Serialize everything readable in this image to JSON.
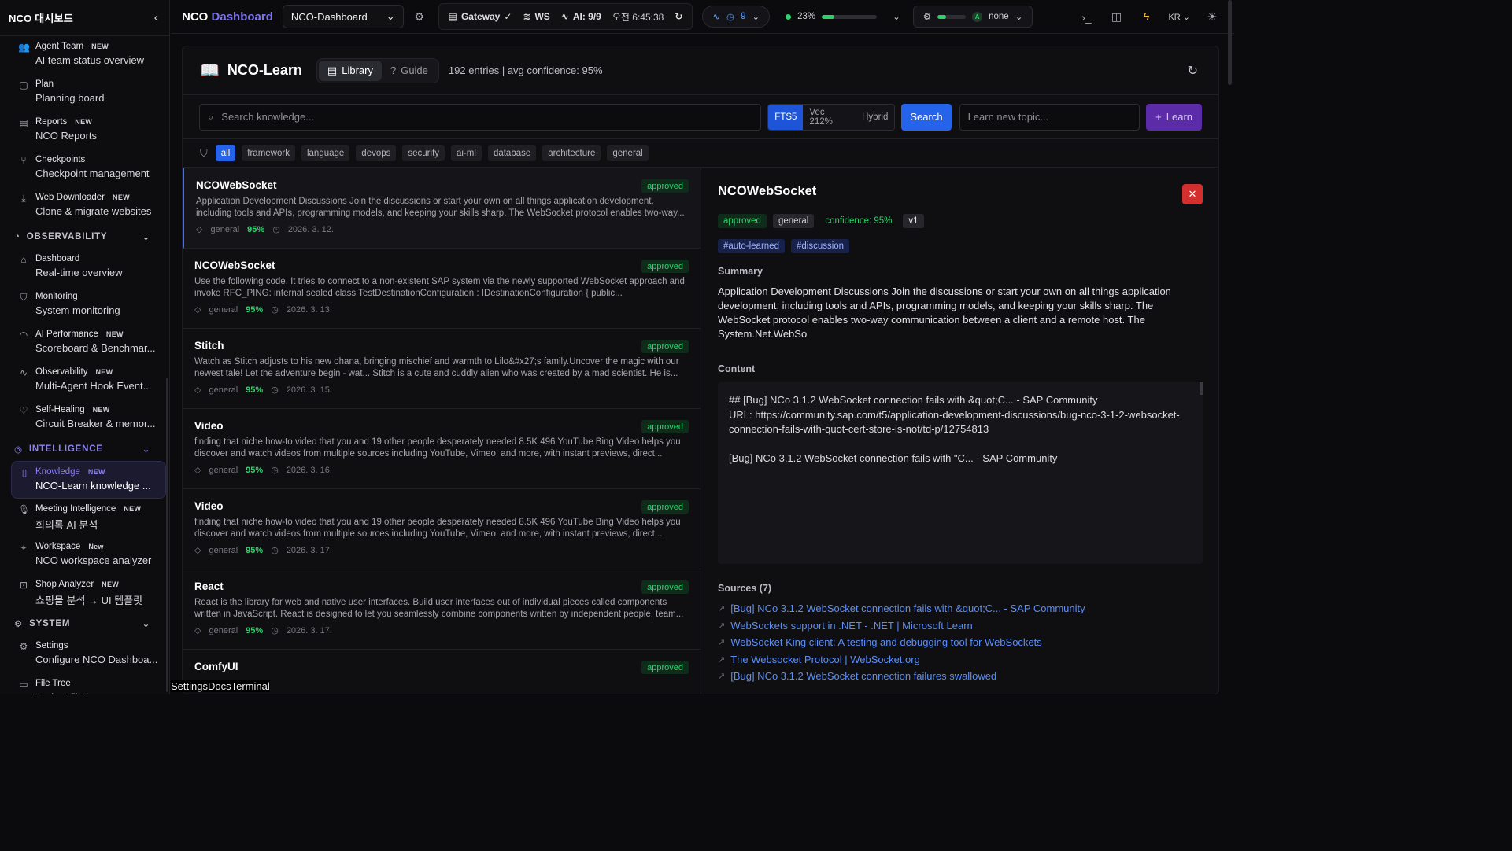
{
  "sidebar": {
    "title": "NCO 대시보드",
    "items_top": [
      {
        "label": "Agent Team",
        "badge": "NEW",
        "sub": "AI team status overview",
        "icon": "users-icon"
      },
      {
        "label": "Plan",
        "badge": "",
        "sub": "Planning board",
        "icon": "clipboard-icon"
      },
      {
        "label": "Reports",
        "badge": "NEW",
        "sub": "NCO Reports",
        "icon": "document-icon"
      },
      {
        "label": "Checkpoints",
        "badge": "",
        "sub": "Checkpoint management",
        "icon": "branch-icon"
      },
      {
        "label": "Web Downloader",
        "badge": "NEW",
        "sub": "Clone & migrate websites",
        "icon": "download-icon"
      }
    ],
    "section_observability": "OBSERVABILITY",
    "items_obs": [
      {
        "label": "Dashboard",
        "badge": "",
        "sub": "Real-time overview",
        "icon": "home-icon"
      },
      {
        "label": "Monitoring",
        "badge": "",
        "sub": "System monitoring",
        "icon": "shield-icon"
      },
      {
        "label": "AI Performance",
        "badge": "NEW",
        "sub": "Scoreboard & Benchmar...",
        "icon": "gauge-icon"
      },
      {
        "label": "Observability",
        "badge": "NEW",
        "sub": "Multi-Agent Hook Event...",
        "icon": "activity-icon"
      },
      {
        "label": "Self-Healing",
        "badge": "NEW",
        "sub": "Circuit Breaker & memor...",
        "icon": "heart-pulse-icon"
      }
    ],
    "section_intelligence": "INTELLIGENCE",
    "items_intel": [
      {
        "label": "Knowledge",
        "badge": "NEW",
        "sub": "NCO-Learn knowledge ...",
        "icon": "book-icon"
      },
      {
        "label": "Meeting Intelligence",
        "badge": "NEW",
        "sub": "회의록 AI 분석",
        "icon": "mic-icon"
      },
      {
        "label": "Workspace",
        "badge": "New",
        "sub": "NCO workspace analyzer",
        "icon": "scan-icon"
      },
      {
        "label": "Shop Analyzer",
        "badge": "NEW",
        "sub": "쇼핑몰 분석 → UI 템플릿",
        "icon": "cart-icon"
      }
    ],
    "section_system": "SYSTEM",
    "items_sys": [
      {
        "label": "Settings",
        "badge": "",
        "sub": "Configure NCO Dashboa...",
        "icon": "gear-icon"
      },
      {
        "label": "File Tree",
        "badge": "",
        "sub": "Project file browser",
        "icon": "folder-icon"
      }
    ]
  },
  "topbar": {
    "brand_main": "NCO",
    "brand_accent": "Dashboard",
    "project": "NCO-Dashboard",
    "gateway": "Gateway",
    "ws": "WS",
    "ai": "AI: 9/9",
    "time": "오전 6:45:38",
    "activity_count": "9",
    "cpu_percent": "23%",
    "cpu_fraction": 0.23,
    "agent_mode": "none",
    "agent_badge": "A",
    "lang": "KR"
  },
  "page": {
    "title": "NCO-Learn",
    "tab_library": "Library",
    "tab_guide": "Guide",
    "stats": "192 entries | avg confidence: 95%"
  },
  "search": {
    "placeholder": "Search knowledge...",
    "mode_fts": "FTS5",
    "mode_vec": "Vec 212%",
    "mode_hybrid": "Hybrid",
    "search_label": "Search",
    "learn_placeholder": "Learn new topic...",
    "learn_label": "Learn"
  },
  "filters": [
    "all",
    "framework",
    "language",
    "devops",
    "security",
    "ai-ml",
    "database",
    "architecture",
    "general"
  ],
  "entries": [
    {
      "title": "NCOWebSocket",
      "status": "approved",
      "desc": "Application Development Discussions Join the discussions or start your own on all things application development, including tools and APIs, programming models, and keeping your skills sharp. The WebSocket protocol enables two-way...",
      "tag": "general",
      "conf": "95%",
      "date": "2026. 3. 12."
    },
    {
      "title": "NCOWebSocket",
      "status": "approved",
      "desc": "Use the following code. It tries to connect to a non-existent SAP system via the newly supported WebSocket approach and invoke RFC_PING: internal sealed class TestDestinationConfiguration : IDestinationConfiguration { public...",
      "tag": "general",
      "conf": "95%",
      "date": "2026. 3. 13."
    },
    {
      "title": "Stitch",
      "status": "approved",
      "desc": "Watch as Stitch adjusts to his new ohana, bringing mischief and warmth to Lilo&#x27;s family.Uncover the magic with our newest tale! Let the adventure begin - wat... Stitch is a cute and cuddly alien who was created by a mad scientist. He is...",
      "tag": "general",
      "conf": "95%",
      "date": "2026. 3. 15."
    },
    {
      "title": "Video",
      "status": "approved",
      "desc": "finding that niche how-to video that you and 19 other people desperately needed 8.5K 496 YouTube Bing Video helps you discover and watch videos from multiple sources including YouTube, Vimeo, and more, with instant previews, direct...",
      "tag": "general",
      "conf": "95%",
      "date": "2026. 3. 16."
    },
    {
      "title": "Video",
      "status": "approved",
      "desc": "finding that niche how-to video that you and 19 other people desperately needed 8.5K 496 YouTube Bing Video helps you discover and watch videos from multiple sources including YouTube, Vimeo, and more, with instant previews, direct...",
      "tag": "general",
      "conf": "95%",
      "date": "2026. 3. 17."
    },
    {
      "title": "React",
      "status": "approved",
      "desc": "React is the library for web and native user interfaces. Build user interfaces out of individual pieces called components written in JavaScript. React is designed to let you seamlessly combine components written by independent people, team...",
      "tag": "general",
      "conf": "95%",
      "date": "2026. 3. 17."
    },
    {
      "title": "ComfyUI",
      "status": "approved",
      "desc": "",
      "tag": "",
      "conf": "",
      "date": ""
    }
  ],
  "detail": {
    "title": "NCOWebSocket",
    "status": "approved",
    "category": "general",
    "confidence": "confidence: 95%",
    "version": "v1",
    "hashtags": [
      "#auto-learned",
      "#discussion"
    ],
    "summary_heading": "Summary",
    "summary": "Application Development Discussions Join the discussions or start your own on all things application development, including tools and APIs, programming models, and keeping your skills sharp. The WebSocket protocol enables two-way communication between a client and a remote host. The System.Net.WebSo",
    "content_heading": "Content",
    "content_lines": [
      "## [Bug] NCo 3.1.2 WebSocket connection fails with &quot;C... - SAP Community\nURL: https://community.sap.com/t5/application-development-discussions/bug-nco-3-1-2-websocket-connection-fails-with-quot-cert-store-is-not/td-p/12754813",
      "[Bug] NCo 3.1.2 WebSocket connection fails with \"C... - SAP Community"
    ],
    "sources_heading": "Sources (7)",
    "sources": [
      "[Bug] NCo 3.1.2 WebSocket connection fails with &quot;C... - SAP Community",
      "WebSockets support in .NET - .NET | Microsoft Learn",
      "WebSocket King client: A testing and debugging tool for WebSockets",
      "The Websocket Protocol | WebSocket.org",
      "[Bug] NCo 3.1.2 WebSocket connection failures swallowed"
    ]
  },
  "bottom_tabs": [
    "Settings",
    "Docs",
    "Terminal"
  ]
}
